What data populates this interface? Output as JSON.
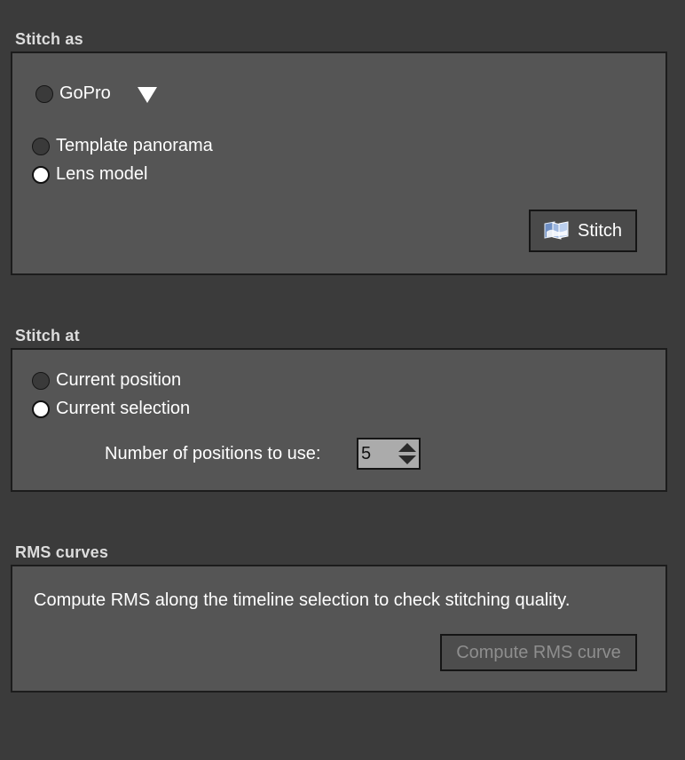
{
  "stitch_as": {
    "title": "Stitch as",
    "preset_option": {
      "label": "GoPro",
      "selected": false
    },
    "options": [
      {
        "label": "Template panorama",
        "selected": false
      },
      {
        "label": "Lens model",
        "selected": true
      }
    ],
    "stitch_button_label": "Stitch"
  },
  "stitch_at": {
    "title": "Stitch at",
    "options": [
      {
        "label": "Current position",
        "selected": false
      },
      {
        "label": "Current selection",
        "selected": true
      }
    ],
    "positions_label": "Number of positions to use:",
    "positions_value": "5"
  },
  "rms_curves": {
    "title": "RMS curves",
    "description": "Compute RMS along the timeline selection to check stitching quality.",
    "compute_button_label": "Compute RMS curve"
  },
  "colors": {
    "background": "#3b3b3b",
    "panel": "#555555",
    "panel_border": "#1c1c1c",
    "text": "#ffffff",
    "disabled_text": "#8e8e8e"
  }
}
